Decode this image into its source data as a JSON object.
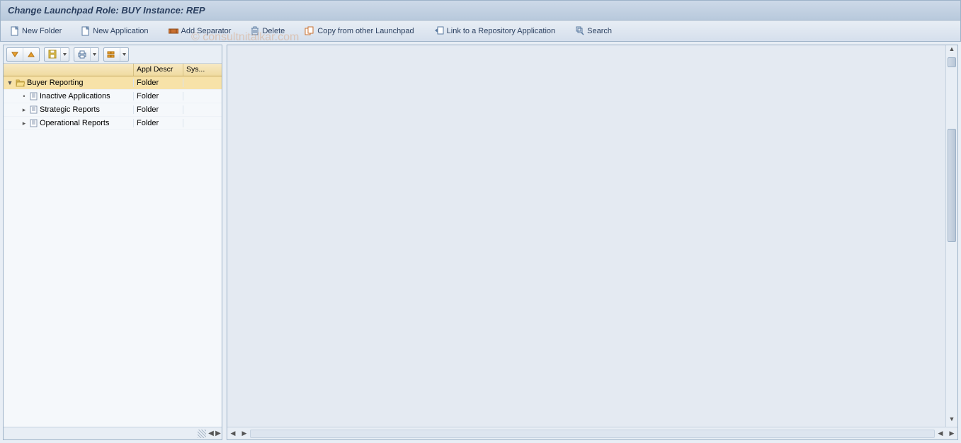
{
  "title": "Change Launchpad Role: BUY Instance: REP",
  "toolbar": {
    "new_folder": "New Folder",
    "new_application": "New Application",
    "add_separator": "Add Separator",
    "delete": "Delete",
    "copy_from": "Copy from other Launchpad",
    "link_repo": "Link to a Repository Application",
    "search": "Search"
  },
  "tree": {
    "header": {
      "col1": "",
      "col2": "Appl Descr",
      "col3": "Sys..."
    },
    "rows": [
      {
        "label": "Buyer Reporting",
        "type": "Folder",
        "icon": "folder-open",
        "indent": 0,
        "toggle": "down",
        "selected": true
      },
      {
        "label": "Inactive Applications",
        "type": "Folder",
        "icon": "document",
        "indent": 1,
        "toggle": "dot",
        "selected": false
      },
      {
        "label": "Strategic Reports",
        "type": "Folder",
        "icon": "document",
        "indent": 1,
        "toggle": "right",
        "selected": false
      },
      {
        "label": "Operational Reports",
        "type": "Folder",
        "icon": "document",
        "indent": 1,
        "toggle": "right",
        "selected": false
      }
    ]
  },
  "watermark": "© consultnitalkar.com"
}
